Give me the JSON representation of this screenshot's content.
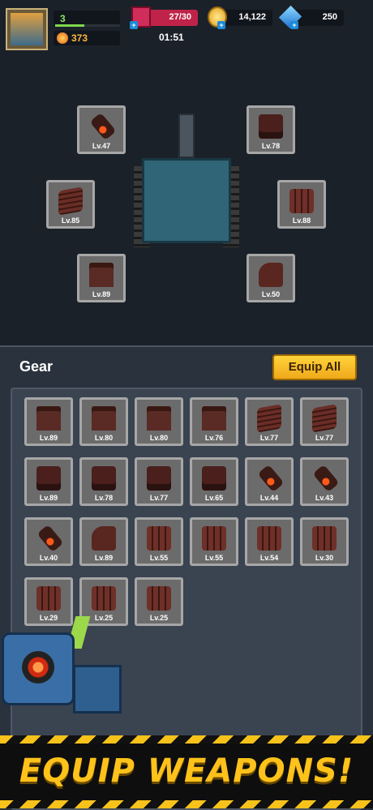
{
  "player": {
    "level": "3",
    "level_progress": 0.45,
    "power": "373"
  },
  "resources": {
    "energy": "27/30",
    "coins": "14,122",
    "gems": "250"
  },
  "timer": "01:51",
  "equipped": [
    {
      "id": "top-left",
      "icon": "cannon",
      "level": "Lv.47"
    },
    {
      "id": "top-right",
      "icon": "robot",
      "level": "Lv.78"
    },
    {
      "id": "mid-left",
      "icon": "tread",
      "level": "Lv.85"
    },
    {
      "id": "mid-right",
      "icon": "armor",
      "level": "Lv.88"
    },
    {
      "id": "bottom-left",
      "icon": "turret",
      "level": "Lv.89"
    },
    {
      "id": "bottom-right",
      "icon": "plate",
      "level": "Lv.50"
    }
  ],
  "gear": {
    "title": "Gear",
    "equip_all_label": "Equip All",
    "items": [
      {
        "icon": "turret",
        "level": "Lv.89"
      },
      {
        "icon": "turret",
        "level": "Lv.80"
      },
      {
        "icon": "turret",
        "level": "Lv.80"
      },
      {
        "icon": "turret",
        "level": "Lv.76"
      },
      {
        "icon": "tread",
        "level": "Lv.77"
      },
      {
        "icon": "tread",
        "level": "Lv.77"
      },
      {
        "icon": "robot",
        "level": "Lv.89"
      },
      {
        "icon": "robot",
        "level": "Lv.78"
      },
      {
        "icon": "robot",
        "level": "Lv.77"
      },
      {
        "icon": "robot",
        "level": "Lv.65"
      },
      {
        "icon": "cannon",
        "level": "Lv.44"
      },
      {
        "icon": "cannon",
        "level": "Lv.43"
      },
      {
        "icon": "cannon",
        "level": "Lv.40"
      },
      {
        "icon": "plate",
        "level": "Lv.89"
      },
      {
        "icon": "armor",
        "level": "Lv.55"
      },
      {
        "icon": "armor",
        "level": "Lv.55"
      },
      {
        "icon": "armor",
        "level": "Lv.54"
      },
      {
        "icon": "armor",
        "level": "Lv.30"
      },
      {
        "icon": "armor",
        "level": "Lv.29"
      },
      {
        "icon": "armor",
        "level": "Lv.25"
      },
      {
        "icon": "armor",
        "level": "Lv.25"
      }
    ]
  },
  "banner": {
    "text": "EQUIP WEAPONS!"
  }
}
